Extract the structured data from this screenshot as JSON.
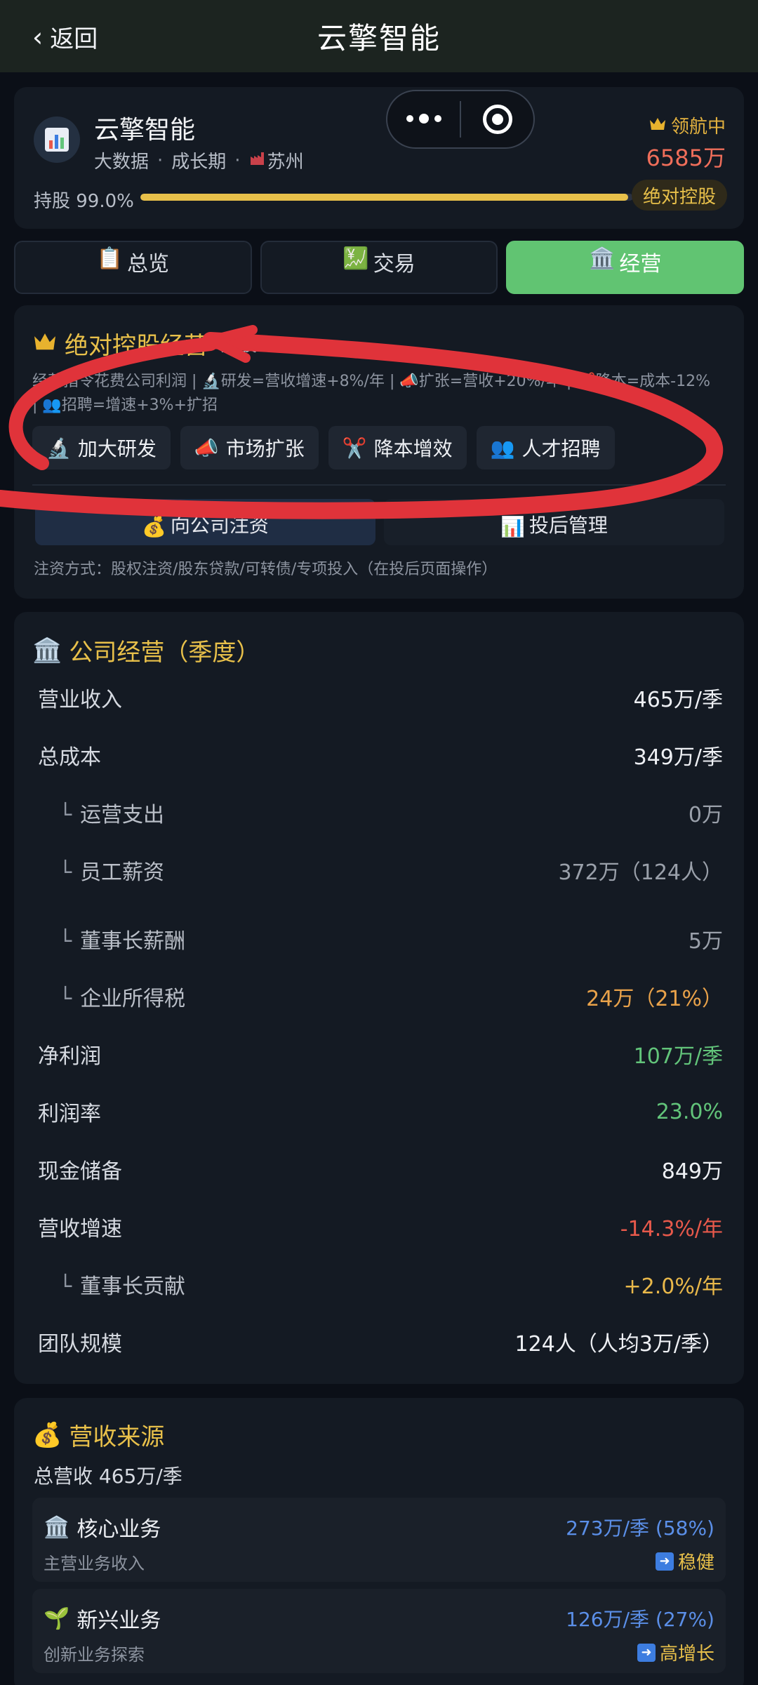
{
  "nav": {
    "back_label": "返回",
    "title": "云擎智能"
  },
  "company": {
    "name": "云擎智能",
    "tags": [
      "大数据",
      "成长期",
      "苏州"
    ],
    "leader_label": "领航中",
    "valuation": "6585万",
    "hold_label": "持股 99.0%",
    "hold_fraction": 0.99,
    "control_badge": "绝对控股"
  },
  "tabs": [
    {
      "label": "总览",
      "icon": "clipboard-icon"
    },
    {
      "label": "交易",
      "icon": "yen-chart-icon"
    },
    {
      "label": "经营",
      "icon": "building-icon",
      "active": true
    }
  ],
  "management": {
    "title": "绝对控股经营",
    "subtitle": "持股99%",
    "description_line1": "经营指令花费公司利润 | 🔬研发=营收增速+8%/年 | 📣扩张=营收+20%/年 | ✂️降本=成本-12%",
    "description_line2": "| 👥招聘=增速+3%+扩招",
    "actions": [
      {
        "label": "加大研发",
        "icon": "microscope-icon"
      },
      {
        "label": "市场扩张",
        "icon": "megaphone-icon"
      },
      {
        "label": "降本增效",
        "icon": "scissors-icon"
      },
      {
        "label": "人才招聘",
        "icon": "people-icon"
      }
    ],
    "invest_primary": "向公司注资",
    "invest_secondary": "投后管理",
    "invest_note": "注资方式：股权注资/股东贷款/可转债/专项投入（在投后页面操作）"
  },
  "operations": {
    "title": "公司经营（季度）",
    "rows": [
      {
        "label": "营业收入",
        "value": "465万/季",
        "color": "white",
        "sub": false
      },
      {
        "label": "总成本",
        "value": "349万/季",
        "color": "white",
        "sub": false
      },
      {
        "label": "运营支出",
        "value": "0万",
        "color": "grey",
        "sub": true
      },
      {
        "label": "员工薪资",
        "value": "372万（124人）",
        "color": "grey",
        "sub": true
      },
      {
        "label": "董事长薪酬",
        "value": "5万",
        "color": "grey",
        "sub": true
      },
      {
        "label": "企业所得税",
        "value": "24万（21%）",
        "color": "orange",
        "sub": true
      },
      {
        "label": "净利润",
        "value": "107万/季",
        "color": "green",
        "sub": false
      },
      {
        "label": "利润率",
        "value": "23.0%",
        "color": "green",
        "sub": false
      },
      {
        "label": "现金储备",
        "value": "849万",
        "color": "white",
        "sub": false
      },
      {
        "label": "营收增速",
        "value": "-14.3%/年",
        "color": "red",
        "sub": false
      },
      {
        "label": "董事长贡献",
        "value": "+2.0%/年",
        "color": "gold",
        "sub": true
      },
      {
        "label": "团队规模",
        "value": "124人（人均3万/季）",
        "color": "white",
        "sub": false
      }
    ]
  },
  "revenue": {
    "title": "营收来源",
    "total": "总营收 465万/季",
    "items": [
      {
        "name": "核心业务",
        "desc": "主营业务收入",
        "amount": "273万/季 (58%)",
        "trend": "稳健",
        "icon": "building-icon"
      },
      {
        "name": "新兴业务",
        "desc": "创新业务探索",
        "amount": "126万/季 (27%)",
        "trend": "高增长",
        "icon": "seedling-icon"
      }
    ]
  },
  "colors": {
    "accent_gold": "#e8c04a",
    "active_tab": "#61c472",
    "positive": "#62c47a",
    "negative": "#e8594b",
    "annotation_red": "#e0333a"
  }
}
